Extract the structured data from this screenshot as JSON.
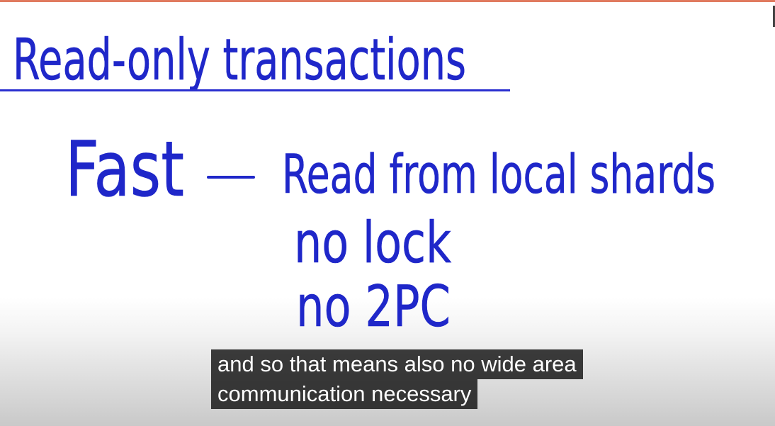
{
  "whiteboard": {
    "title": "Read-only transactions",
    "term": "Fast",
    "points": [
      "Read from local shards",
      "no lock",
      "no 2PC"
    ]
  },
  "captions": {
    "line1": "and so that means also no wide area",
    "line2": "communication necessary"
  },
  "colors": {
    "ink": "#1f27c9",
    "caption_bg": "#141414",
    "top_rule": "#e07a5f"
  }
}
